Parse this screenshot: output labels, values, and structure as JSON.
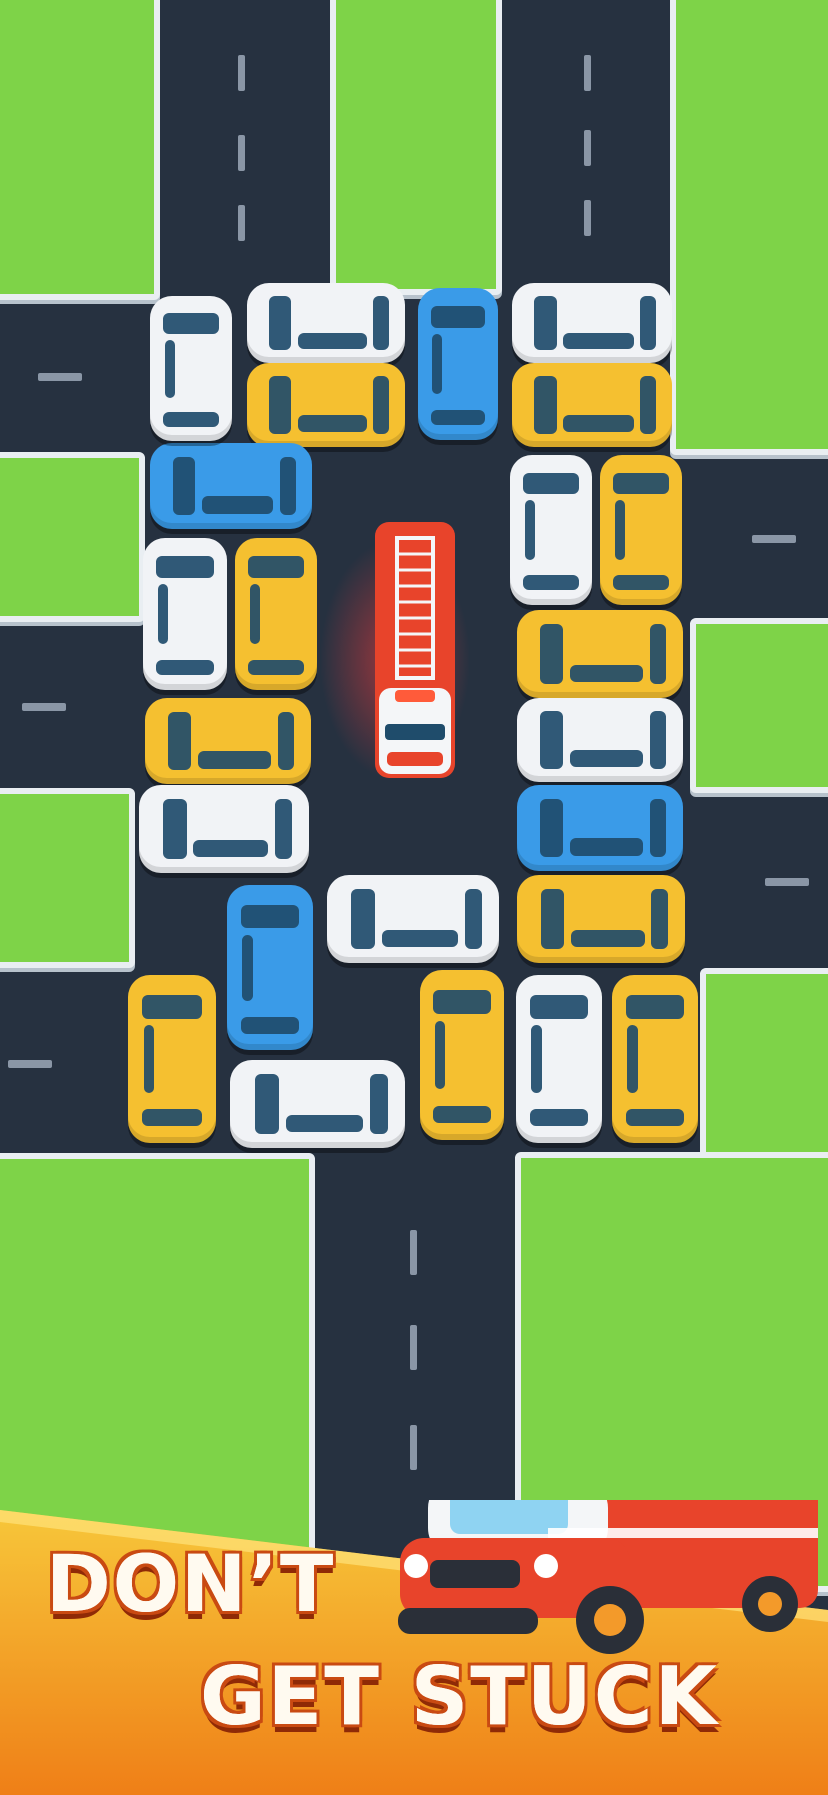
{
  "banner": {
    "line1": "DON’T",
    "line2": "GET STUCK"
  },
  "colors": {
    "road": "#263140",
    "grass": "#7ed348",
    "curb": "#e9eef2",
    "car_white": "#f1f3f6",
    "car_yellow": "#f5c030",
    "car_blue": "#3a9be8",
    "fire_truck": "#e8442b",
    "banner_orange": "#f08a1c",
    "banner_yellow": "#f7c73a"
  },
  "game": {
    "target_vehicle": "fire-truck"
  }
}
